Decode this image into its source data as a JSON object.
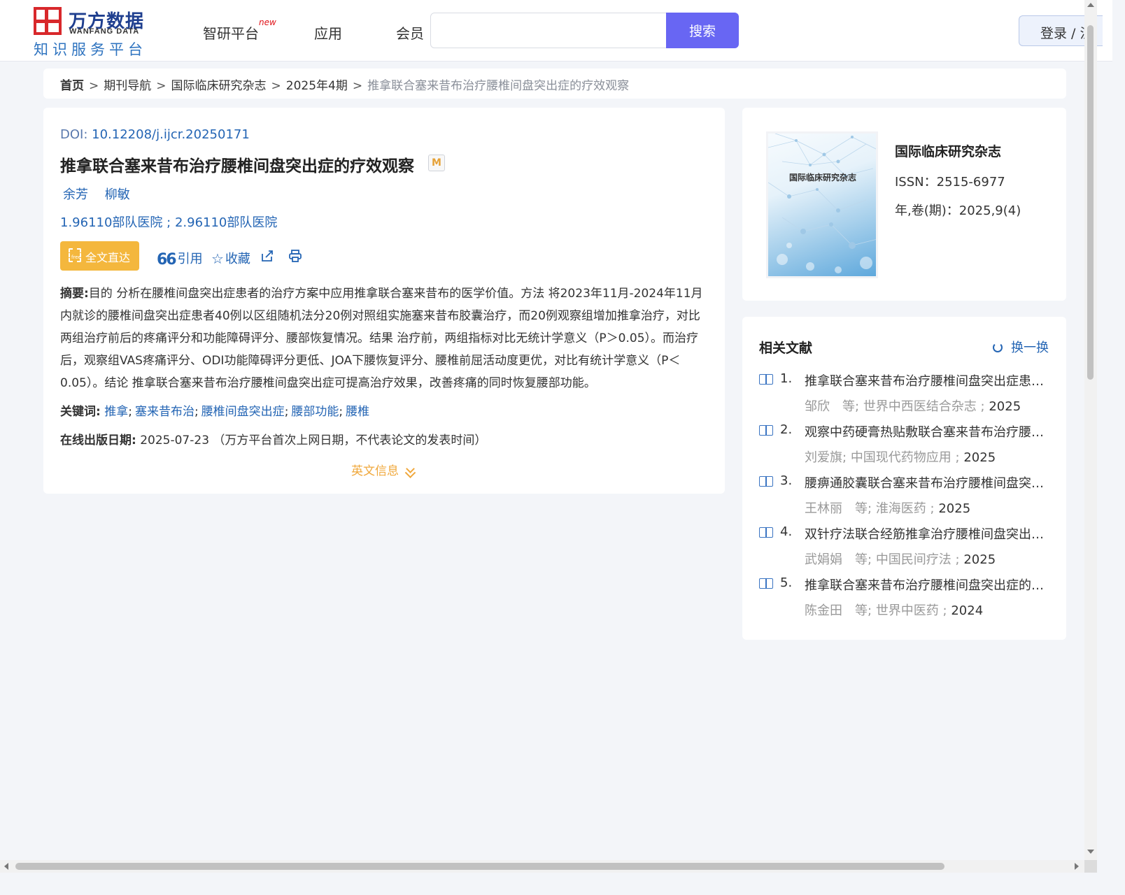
{
  "header": {
    "logo_cn": "万方数据",
    "logo_en": "WANFANG DATA",
    "logo_sub": "知识服务平台",
    "nav": [
      {
        "label": "智研平台",
        "badge": "new"
      },
      {
        "label": "应用"
      },
      {
        "label": "会员"
      }
    ],
    "search": {
      "placeholder": "",
      "value": "",
      "button_label": "搜索"
    },
    "login_label": "登录 / 注"
  },
  "breadcrumb": {
    "items": [
      "首页",
      "期刊导航",
      "国际临床研究杂志",
      "2025年4期"
    ],
    "current": "推拿联合塞来昔布治疗腰椎间盘突出症的疗效观察",
    "separator": ">"
  },
  "article": {
    "doi_label": "DOI:",
    "doi": "10.12208/j.ijcr.20250171",
    "title": "推拿联合塞来昔布治疗腰椎间盘突出症的疗效观察",
    "badge": "M",
    "authors": [
      "余芳",
      "柳敏"
    ],
    "affiliations": "1.96110部队医院 ; 2.96110部队医院",
    "actions": {
      "fulltext": "全文直达",
      "cite": "引用",
      "favorite": "收藏"
    },
    "abstract_label": "摘要:",
    "abstract": "目的 分析在腰椎间盘突出症患者的治疗方案中应用推拿联合塞来昔布的医学价值。方法 将2023年11月-2024年11月内就诊的腰椎间盘突出症患者40例以区组随机法分20例对照组实施塞来昔布胶囊治疗，而20例观察组增加推拿治疗，对比两组治疗前后的疼痛评分和功能障碍评分、腰部恢复情况。结果 治疗前，两组指标对比无统计学意义（P＞0.05）。而治疗后，观察组VAS疼痛评分、ODI功能障碍评分更低、JOA下腰恢复评分、腰椎前屈活动度更优，对比有统计学意义（P＜0.05）。结论 推拿联合塞来昔布治疗腰椎间盘突出症可提高治疗效果，改善疼痛的同时恢复腰部功能。",
    "keywords_label": "关键词:",
    "keywords": [
      "推拿",
      "塞来昔布治",
      "腰椎间盘突出症",
      "腰部功能",
      "腰椎"
    ],
    "pubdate_label": "在线出版日期:",
    "pubdate": "2025-07-23",
    "pubdate_note": "（万方平台首次上网日期，不代表论文的发表时间）",
    "en_info_label": "英文信息"
  },
  "journal": {
    "cover_title": "国际临床研究杂志",
    "name": "国际临床研究杂志",
    "issn": "ISSN：2515-6977",
    "volume": "年,卷(期)：2025,9(4)"
  },
  "related": {
    "title": "相关文献",
    "refresh_label": "换一换",
    "items": [
      {
        "num": "1.",
        "title": "推拿联合塞来昔布治疗腰椎间盘突出症患者...",
        "authors": "邹欣　等;",
        "source": "世界中西医结合杂志 ;",
        "year": "2025"
      },
      {
        "num": "2.",
        "title": "观察中药硬膏热贴敷联合塞来昔布治疗腰椎...",
        "authors": "刘爱旗;",
        "source": "中国现代药物应用 ;",
        "year": "2025"
      },
      {
        "num": "3.",
        "title": "腰痹通胶囊联合塞来昔布治疗腰椎间盘突出...",
        "authors": "王林丽　等;",
        "source": "淮海医药 ;",
        "year": "2025"
      },
      {
        "num": "4.",
        "title": "双针疗法联合经筋推拿治疗腰椎间盘突出症...",
        "authors": "武娟娟　等;",
        "source": "中国民间疗法 ;",
        "year": "2025"
      },
      {
        "num": "5.",
        "title": "推拿联合塞来昔布治疗腰椎间盘突出症的疗...",
        "authors": "陈金田　等;",
        "source": "世界中医药 ;",
        "year": "2024"
      }
    ]
  }
}
